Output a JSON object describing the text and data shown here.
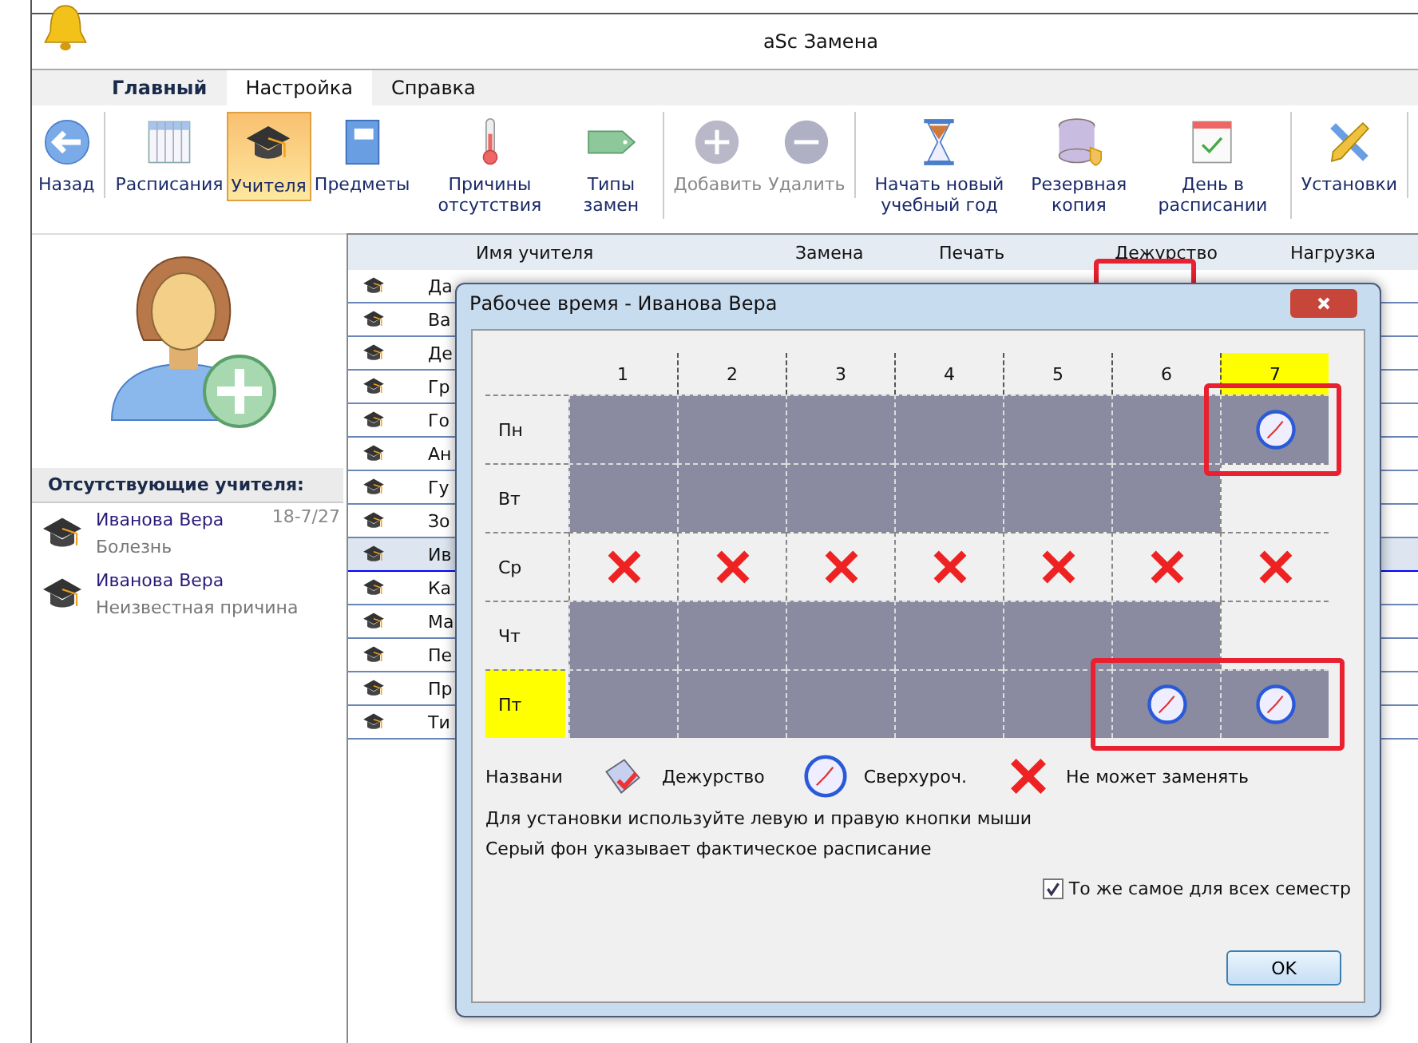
{
  "window": {
    "title": "aSc Замена"
  },
  "tabs": [
    {
      "label": "Главный",
      "selected": false,
      "kind": "menu"
    },
    {
      "label": "Настройка",
      "selected": true,
      "kind": "tab"
    },
    {
      "label": "Справка",
      "selected": false,
      "kind": "tab"
    }
  ],
  "toolbar": [
    {
      "label": "Назад",
      "selected": false,
      "disabled": false,
      "sep": true
    },
    {
      "label": "Расписания",
      "selected": false,
      "disabled": false,
      "sep": false
    },
    {
      "label": "Учителя",
      "selected": true,
      "disabled": false,
      "sep": false
    },
    {
      "label": "Предметы",
      "selected": false,
      "disabled": false,
      "sep": false
    },
    {
      "label": "Причины отсутствия",
      "selected": false,
      "disabled": false,
      "sep": false
    },
    {
      "label": "Типы замен",
      "selected": false,
      "disabled": false,
      "sep": true
    },
    {
      "label": "Добавить",
      "selected": false,
      "disabled": true,
      "sep": false
    },
    {
      "label": "Удалить",
      "selected": false,
      "disabled": true,
      "sep": true
    },
    {
      "label": "Начать новый учебный год",
      "selected": false,
      "disabled": false,
      "sep": false
    },
    {
      "label": "Резервная копия",
      "selected": false,
      "disabled": false,
      "sep": false
    },
    {
      "label": "День в расписании",
      "selected": false,
      "disabled": false,
      "sep": true
    },
    {
      "label": "Установки",
      "selected": false,
      "disabled": false,
      "sep": true
    }
  ],
  "absent": {
    "title": "Отсутствующие учителя:",
    "items": [
      {
        "name": "Иванова Вера",
        "reason": "Болезнь",
        "date": "18-7/27"
      },
      {
        "name": "Иванова Вера",
        "reason": "Неизвестная причина"
      }
    ]
  },
  "table": {
    "columns": [
      "Имя учителя",
      "Замена",
      "Печать",
      "Дежурство",
      "Нагрузка"
    ],
    "rows": [
      {
        "name": "Да",
        "selected": false
      },
      {
        "name": "Ва",
        "selected": false
      },
      {
        "name": "Де",
        "selected": false
      },
      {
        "name": "Гр",
        "selected": false
      },
      {
        "name": "Го",
        "selected": false
      },
      {
        "name": "Ан",
        "selected": false
      },
      {
        "name": "Гу",
        "selected": false
      },
      {
        "name": "Зо",
        "selected": false
      },
      {
        "name": "Ив",
        "selected": true
      },
      {
        "name": "Ка",
        "selected": false
      },
      {
        "name": "Ма",
        "selected": false
      },
      {
        "name": "Пе",
        "selected": false
      },
      {
        "name": "Пр",
        "selected": false
      },
      {
        "name": "Ти",
        "selected": false
      }
    ]
  },
  "dialog": {
    "title": "Рабочее время - Иванова Вера",
    "periods": [
      {
        "label": "1",
        "selected": false
      },
      {
        "label": "2",
        "selected": false
      },
      {
        "label": "3",
        "selected": false
      },
      {
        "label": "4",
        "selected": false
      },
      {
        "label": "5",
        "selected": false
      },
      {
        "label": "6",
        "selected": false
      },
      {
        "label": "7",
        "selected": true
      }
    ],
    "days": [
      {
        "label": "Пн",
        "selected": false,
        "cells": [
          {
            "kind": "busy"
          },
          {
            "kind": "busy"
          },
          {
            "kind": "busy"
          },
          {
            "kind": "busy"
          },
          {
            "kind": "busy"
          },
          {
            "kind": "busy"
          },
          {
            "kind": "overtime"
          }
        ]
      },
      {
        "label": "Вт",
        "selected": false,
        "cells": [
          {
            "kind": "busy"
          },
          {
            "kind": "busy"
          },
          {
            "kind": "busy"
          },
          {
            "kind": "busy"
          },
          {
            "kind": "busy"
          },
          {
            "kind": "busy"
          },
          {
            "kind": "free"
          }
        ]
      },
      {
        "label": "Ср",
        "selected": false,
        "cells": [
          {
            "kind": "cannot"
          },
          {
            "kind": "cannot"
          },
          {
            "kind": "cannot"
          },
          {
            "kind": "cannot"
          },
          {
            "kind": "cannot"
          },
          {
            "kind": "cannot"
          },
          {
            "kind": "cannot"
          }
        ]
      },
      {
        "label": "Чт",
        "selected": false,
        "cells": [
          {
            "kind": "busy"
          },
          {
            "kind": "busy"
          },
          {
            "kind": "busy"
          },
          {
            "kind": "busy"
          },
          {
            "kind": "busy"
          },
          {
            "kind": "busy"
          },
          {
            "kind": "free"
          }
        ]
      },
      {
        "label": "Пт",
        "selected": true,
        "cells": [
          {
            "kind": "busy"
          },
          {
            "kind": "busy"
          },
          {
            "kind": "busy"
          },
          {
            "kind": "busy"
          },
          {
            "kind": "busy"
          },
          {
            "kind": "overtime"
          },
          {
            "kind": "overtime"
          }
        ]
      }
    ],
    "legend": [
      {
        "kind": "text",
        "label": "Названи"
      },
      {
        "kind": "duty",
        "label": "Дежурство"
      },
      {
        "kind": "overtime",
        "label": "Сверхуроч."
      },
      {
        "kind": "cannot",
        "label": "Не может заменять"
      }
    ],
    "hints": [
      "Для установки используйте левую и правую кнопки мыши",
      "Серый фон указывает фактическое расписание"
    ],
    "same_for_all": {
      "label": "То же самое для всех семестр",
      "checked": true
    },
    "ok": "OK"
  }
}
